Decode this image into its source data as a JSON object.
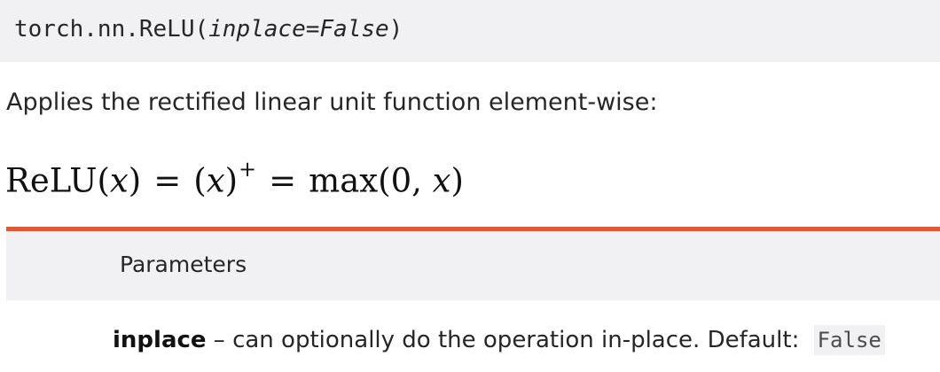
{
  "signature": {
    "prefix": "torch.nn.ReLU(",
    "argument": "inplace=False",
    "suffix": ")"
  },
  "description": "Applies the rectified linear unit function element-wise:",
  "formula": {
    "lhs_name": "ReLU",
    "open_paren": "(",
    "variable": "x",
    "close_paren": ")",
    "equals": "=",
    "superscript": "+",
    "rhs_name": "max",
    "zero": "0",
    "comma": ","
  },
  "parameters": {
    "heading": "Parameters",
    "items": [
      {
        "name": "inplace",
        "text": " – can optionally do the operation in-place. Default: ",
        "default": "False"
      }
    ]
  },
  "colors": {
    "accent": "#e05937",
    "panel_background": "#f1f1f4"
  }
}
